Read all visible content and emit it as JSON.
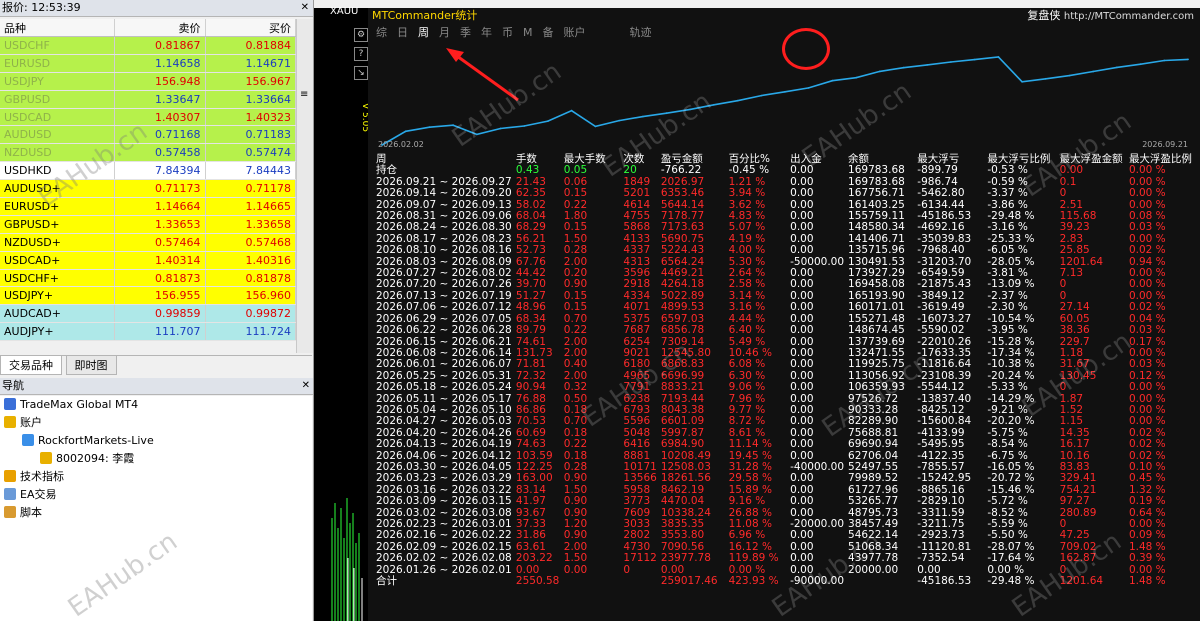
{
  "left": {
    "market_watch": {
      "title": "报价: 12:53:39",
      "headers": {
        "symbol": "品种",
        "bid": "卖价",
        "ask": "买价"
      },
      "rows": [
        {
          "symbol": "USDCHF",
          "bid": "0.81867",
          "ask": "0.81884",
          "bg": "lime"
        },
        {
          "symbol": "EURUSD",
          "bid": "1.14658",
          "ask": "1.14671",
          "bg": "lime"
        },
        {
          "symbol": "USDJPY",
          "bid": "156.948",
          "ask": "156.967",
          "bg": "lime"
        },
        {
          "symbol": "GBPUSD",
          "bid": "1.33647",
          "ask": "1.33664",
          "bg": "lime"
        },
        {
          "symbol": "USDCAD",
          "bid": "1.40307",
          "ask": "1.40323",
          "bg": "lime"
        },
        {
          "symbol": "AUDUSD",
          "bid": "0.71168",
          "ask": "0.71183",
          "bg": "lime"
        },
        {
          "symbol": "NZDUSD",
          "bid": "0.57458",
          "ask": "0.57474",
          "bg": "lime"
        },
        {
          "symbol": "USDHKD",
          "bid": "7.84394",
          "ask": "7.84443",
          "bg": "white"
        },
        {
          "symbol": "AUDUSD+",
          "bid": "0.71173",
          "ask": "0.71178",
          "bg": "yellow"
        },
        {
          "symbol": "EURUSD+",
          "bid": "1.14664",
          "ask": "1.14665",
          "bg": "yellow"
        },
        {
          "symbol": "GBPUSD+",
          "bid": "1.33653",
          "ask": "1.33658",
          "bg": "yellow"
        },
        {
          "symbol": "NZDUSD+",
          "bid": "0.57464",
          "ask": "0.57468",
          "bg": "yellow"
        },
        {
          "symbol": "USDCAD+",
          "bid": "1.40314",
          "ask": "1.40316",
          "bg": "yellow"
        },
        {
          "symbol": "USDCHF+",
          "bid": "0.81873",
          "ask": "0.81878",
          "bg": "yellow"
        },
        {
          "symbol": "USDJPY+",
          "bid": "156.955",
          "ask": "156.960",
          "bg": "yellow"
        },
        {
          "symbol": "AUDCAD+",
          "bid": "0.99859",
          "ask": "0.99872",
          "bg": "cyan"
        },
        {
          "symbol": "AUDJPY+",
          "bid": "111.707",
          "ask": "111.724",
          "bg": "cyan"
        }
      ],
      "tabs": [
        "交易品种",
        "即时图"
      ]
    },
    "navigator": {
      "title": "导航",
      "items": [
        {
          "label": "TradeMax Global MT4",
          "level": 0,
          "icon": "terminal-icon"
        },
        {
          "label": "账户",
          "level": 0,
          "icon": "accounts-icon"
        },
        {
          "label": "RockfortMarkets-Live",
          "level": 1,
          "icon": "server-icon"
        },
        {
          "label": "8002094: 李霞",
          "level": 2,
          "icon": "user-icon"
        },
        {
          "label": "技术指标",
          "level": 0,
          "icon": "indicators-icon"
        },
        {
          "label": "EA交易",
          "level": 0,
          "icon": "expert-advisor-icon"
        },
        {
          "label": "脚本",
          "level": 0,
          "icon": "scripts-icon"
        }
      ]
    }
  },
  "chart": {
    "symbol_tab": "XAUU",
    "ea_version": "V 5.05",
    "mt_title": "MTCommander统计",
    "brand_name": "复盘侠",
    "brand_url": "http://MTCommander.com",
    "periods": [
      {
        "label": "综",
        "selected": false
      },
      {
        "label": "日",
        "selected": false
      },
      {
        "label": "周",
        "selected": true
      },
      {
        "label": "月",
        "selected": false
      },
      {
        "label": "季",
        "selected": false
      },
      {
        "label": "年",
        "selected": false
      },
      {
        "label": "币",
        "selected": false
      },
      {
        "label": "M",
        "selected": false
      },
      {
        "label": "备",
        "selected": false
      },
      {
        "label": "账户",
        "selected": false
      }
    ],
    "trace_label": "轨迹",
    "axis_start": "2026.02.02",
    "axis_end": "2026.09.21",
    "colors": {
      "loss": "#ff2a2a",
      "gain": "#2bff3a",
      "line": "#29a8e8",
      "highlight": "#ff1e1e"
    }
  },
  "chart_data": {
    "type": "line",
    "x": [
      "2026.02.02",
      "2026.02.09",
      "2026.02.16",
      "2026.02.23",
      "2026.03.02",
      "2026.03.09",
      "2026.03.16",
      "2026.03.23",
      "2026.03.30",
      "2026.04.06",
      "2026.04.13",
      "2026.04.20",
      "2026.04.27",
      "2026.05.04",
      "2026.05.11",
      "2026.05.18",
      "2026.05.25",
      "2026.06.01",
      "2026.06.08",
      "2026.06.15",
      "2026.06.22",
      "2026.06.29",
      "2026.07.06",
      "2026.07.13",
      "2026.07.20",
      "2026.07.27",
      "2026.08.03",
      "2026.08.10",
      "2026.08.17",
      "2026.08.24",
      "2026.08.31",
      "2026.09.07",
      "2026.09.14",
      "2026.09.21"
    ],
    "series": [
      {
        "values": [
          20000.0,
          43977.78,
          51068.34,
          54622.14,
          38457.49,
          48795.73,
          53265.77,
          61727.96,
          79989.52,
          52497.55,
          62706.04,
          69690.94,
          75688.81,
          82289.9,
          90333.28,
          97526.72,
          106359.93,
          113056.92,
          119925.75,
          132471.55,
          137739.69,
          148674.45,
          155271.48,
          160171.01,
          165193.9,
          169458.08,
          173927.29,
          130491.53,
          135715.96,
          141406.71,
          148580.34,
          155759.11,
          161403.25,
          167756.71,
          169783.68
        ]
      }
    ],
    "xlabel": "",
    "ylabel": ""
  },
  "stats": {
    "headers": [
      "周",
      "手数",
      "最大手数",
      "次数",
      "盈亏金额",
      "百分比%",
      "出入金",
      "余额",
      "最大浮亏",
      "最大浮亏比例",
      "最大浮盈金额",
      "最大浮盈比例"
    ],
    "holding": [
      "持仓",
      "0.43",
      "0.05",
      "20",
      "-766.22",
      "-0.45 %",
      "0.00",
      "169783.68",
      "-899.79",
      "-0.53 %",
      "0.00",
      "0.00 %"
    ],
    "rows": [
      [
        "2026.09.21 ~ 2026.09.27",
        "21.43",
        "0.06",
        "1849",
        "2026.97",
        "1.21 %",
        "0.00",
        "169783.68",
        "-986.74",
        "-0.59 %",
        "0.1",
        "0.00 %"
      ],
      [
        "2026.09.14 ~ 2026.09.20",
        "62.35",
        "0.15",
        "5201",
        "6353.46",
        "3.94 %",
        "0.00",
        "167756.71",
        "-5462.80",
        "-3.37 %",
        "0",
        "0.00 %"
      ],
      [
        "2026.09.07 ~ 2026.09.13",
        "58.02",
        "0.22",
        "4614",
        "5644.14",
        "3.62 %",
        "0.00",
        "161403.25",
        "-6134.44",
        "-3.86 %",
        "2.51",
        "0.00 %"
      ],
      [
        "2026.08.31 ~ 2026.09.06",
        "68.04",
        "1.80",
        "4755",
        "7178.77",
        "4.83 %",
        "0.00",
        "155759.11",
        "-45186.53",
        "-29.48 %",
        "115.68",
        "0.08 %"
      ],
      [
        "2026.08.24 ~ 2026.08.30",
        "68.29",
        "0.15",
        "5868",
        "7173.63",
        "5.07 %",
        "0.00",
        "148580.34",
        "-4692.16",
        "-3.16 %",
        "39.23",
        "0.03 %"
      ],
      [
        "2026.08.17 ~ 2026.08.23",
        "56.21",
        "1.50",
        "4133",
        "5690.75",
        "4.19 %",
        "0.00",
        "141406.71",
        "-35039.83",
        "-25.33 %",
        "2.83",
        "0.00 %"
      ],
      [
        "2026.08.10 ~ 2026.08.16",
        "52.73",
        "0.28",
        "4337",
        "5224.43",
        "4.00 %",
        "0.00",
        "135715.96",
        "-7968.40",
        "-6.05 %",
        "25.85",
        "0.02 %"
      ],
      [
        "2026.08.03 ~ 2026.08.09",
        "67.76",
        "2.00",
        "4313",
        "6564.24",
        "5.30 %",
        "-50000.00",
        "130491.53",
        "-31203.70",
        "-28.05 %",
        "1201.64",
        "0.94 %"
      ],
      [
        "2026.07.27 ~ 2026.08.02",
        "44.42",
        "0.20",
        "3596",
        "4469.21",
        "2.64 %",
        "0.00",
        "173927.29",
        "-6549.59",
        "-3.81 %",
        "7.13",
        "0.00 %"
      ],
      [
        "2026.07.20 ~ 2026.07.26",
        "39.70",
        "0.90",
        "2918",
        "4264.18",
        "2.58 %",
        "0.00",
        "169458.08",
        "-21875.43",
        "-13.09 %",
        "0",
        "0.00 %"
      ],
      [
        "2026.07.13 ~ 2026.07.19",
        "51.27",
        "0.15",
        "4334",
        "5022.89",
        "3.14 %",
        "0.00",
        "165193.90",
        "-3849.12",
        "-2.37 %",
        "0",
        "0.00 %"
      ],
      [
        "2026.07.06 ~ 2026.07.12",
        "48.96",
        "0.15",
        "4071",
        "4899.53",
        "3.16 %",
        "0.00",
        "160171.01",
        "-3619.49",
        "-2.30 %",
        "27.14",
        "0.02 %"
      ],
      [
        "2026.06.29 ~ 2026.07.05",
        "68.34",
        "0.70",
        "5375",
        "6597.03",
        "4.44 %",
        "0.00",
        "155271.48",
        "-16073.27",
        "-10.54 %",
        "60.05",
        "0.04 %"
      ],
      [
        "2026.06.22 ~ 2026.06.28",
        "89.79",
        "0.22",
        "7687",
        "6856.78",
        "6.40 %",
        "0.00",
        "148674.45",
        "-5590.02",
        "-3.95 %",
        "38.36",
        "0.03 %"
      ],
      [
        "2026.06.15 ~ 2026.06.21",
        "74.61",
        "2.00",
        "6254",
        "7309.14",
        "5.49 %",
        "0.00",
        "137739.69",
        "-22010.26",
        "-15.28 %",
        "229.7",
        "0.17 %"
      ],
      [
        "2026.06.08 ~ 2026.06.14",
        "131.73",
        "2.00",
        "9021",
        "12545.80",
        "10.46 %",
        "0.00",
        "132471.55",
        "-17633.35",
        "-17.34 %",
        "1.18",
        "0.00 %"
      ],
      [
        "2026.06.01 ~ 2026.06.07",
        "71.81",
        "0.40",
        "6180",
        "6868.83",
        "6.08 %",
        "0.00",
        "119925.75",
        "-11816.64",
        "-10.38 %",
        "31.67",
        "0.03 %"
      ],
      [
        "2026.05.25 ~ 2026.05.31",
        "72.32",
        "2.00",
        "4965",
        "6696.99",
        "6.30 %",
        "0.00",
        "113056.92",
        "-23108.39",
        "-20.24 %",
        "130.45",
        "0.12 %"
      ],
      [
        "2026.05.18 ~ 2026.05.24",
        "90.94",
        "0.32",
        "7791",
        "8833.21",
        "9.06 %",
        "0.00",
        "106359.93",
        "-5544.12",
        "-5.33 %",
        "0",
        "0.00 %"
      ],
      [
        "2026.05.11 ~ 2026.05.17",
        "76.88",
        "0.50",
        "6238",
        "7193.44",
        "7.96 %",
        "0.00",
        "97526.72",
        "-13837.40",
        "-14.29 %",
        "1.87",
        "0.00 %"
      ],
      [
        "2026.05.04 ~ 2026.05.10",
        "86.86",
        "0.18",
        "6793",
        "8043.38",
        "9.77 %",
        "0.00",
        "90333.28",
        "-8425.12",
        "-9.21 %",
        "1.52",
        "0.00 %"
      ],
      [
        "2026.04.27 ~ 2026.05.03",
        "70.53",
        "0.70",
        "5596",
        "6601.09",
        "8.72 %",
        "0.00",
        "82289.90",
        "-15600.84",
        "-20.20 %",
        "1.15",
        "0.00 %"
      ],
      [
        "2026.04.20 ~ 2026.04.26",
        "60.69",
        "0.18",
        "5048",
        "5997.87",
        "8.61 %",
        "0.00",
        "75688.81",
        "-4133.99",
        "-5.75 %",
        "14.35",
        "0.02 %"
      ],
      [
        "2026.04.13 ~ 2026.04.19",
        "74.63",
        "0.22",
        "6416",
        "6984.90",
        "11.14 %",
        "0.00",
        "69690.94",
        "-5495.95",
        "-8.54 %",
        "16.17",
        "0.02 %"
      ],
      [
        "2026.04.06 ~ 2026.04.12",
        "103.59",
        "0.18",
        "8881",
        "10208.49",
        "19.45 %",
        "0.00",
        "62706.04",
        "-4122.35",
        "-6.75 %",
        "10.16",
        "0.02 %"
      ],
      [
        "2026.03.30 ~ 2026.04.05",
        "122.25",
        "0.28",
        "10171",
        "12508.03",
        "31.28 %",
        "-40000.00",
        "52497.55",
        "-7855.57",
        "-16.05 %",
        "83.83",
        "0.10 %"
      ],
      [
        "2026.03.23 ~ 2026.03.29",
        "163.00",
        "0.90",
        "13566",
        "18261.56",
        "29.58 %",
        "0.00",
        "79989.52",
        "-15242.95",
        "-20.72 %",
        "329.41",
        "0.45 %"
      ],
      [
        "2026.03.16 ~ 2026.03.22",
        "83.14",
        "1.50",
        "5958",
        "8462.19",
        "15.89 %",
        "0.00",
        "61727.96",
        "-8865.16",
        "-15.46 %",
        "754.21",
        "1.32 %"
      ],
      [
        "2026.03.09 ~ 2026.03.15",
        "41.97",
        "0.90",
        "3773",
        "4470.04",
        "9.16 %",
        "0.00",
        "53265.77",
        "-2829.10",
        "-5.72 %",
        "97.27",
        "0.19 %"
      ],
      [
        "2026.03.02 ~ 2026.03.08",
        "93.67",
        "0.90",
        "7609",
        "10338.24",
        "26.88 %",
        "0.00",
        "48795.73",
        "-3311.59",
        "-8.52 %",
        "280.89",
        "0.64 %"
      ],
      [
        "2026.02.23 ~ 2026.03.01",
        "37.33",
        "1.20",
        "3033",
        "3835.35",
        "11.08 %",
        "-20000.00",
        "38457.49",
        "-3211.75",
        "-5.59 %",
        "0",
        "0.00 %"
      ],
      [
        "2026.02.16 ~ 2026.02.22",
        "31.86",
        "0.90",
        "2802",
        "3553.80",
        "6.96 %",
        "0.00",
        "54622.14",
        "-2923.73",
        "-5.50 %",
        "47.25",
        "0.09 %"
      ],
      [
        "2026.02.09 ~ 2026.02.15",
        "63.61",
        "2.00",
        "4730",
        "7090.56",
        "16.12 %",
        "0.00",
        "51068.34",
        "-11120.81",
        "-28.07 %",
        "709.02",
        "1.48 %"
      ],
      [
        "2026.02.02 ~ 2026.02.08",
        "203.22",
        "1.50",
        "17112",
        "23977.78",
        "119.89 %",
        "0.00",
        "43977.78",
        "-7352.54",
        "-17.64 %",
        "162.87",
        "0.39 %"
      ],
      [
        "2026.01.26 ~ 2026.02.01",
        "0.00",
        "0.00",
        "0",
        "0.00",
        "0.00 %",
        "0.00",
        "20000.00",
        "0.00",
        "0.00 %",
        "0",
        "0.00 %"
      ]
    ],
    "total": [
      "合计",
      "2550.58",
      "",
      "",
      "259017.46",
      "423.93 %",
      "-90000.00",
      "",
      "-45186.53",
      "-29.48 %",
      "1201.64",
      "1.48 %"
    ]
  },
  "watermark": "EAHub.cn"
}
